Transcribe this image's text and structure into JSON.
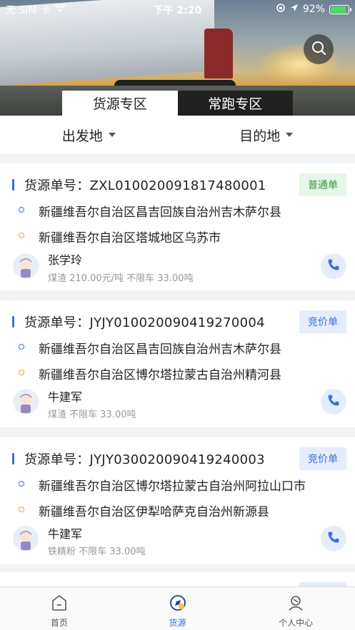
{
  "status_bar": {
    "carrier": "无 SIM 卡",
    "time": "下午 2:20",
    "battery": "92%",
    "battery_level": 0.92
  },
  "header": {
    "search_icon": "search-icon",
    "tabs": [
      {
        "label": "货源专区",
        "active": true
      },
      {
        "label": "常跑专区",
        "active": false
      }
    ]
  },
  "filters": {
    "origin_label": "出发地",
    "destination_label": "目的地"
  },
  "cards": [
    {
      "order_label": "货源单号：",
      "order_no": "ZXL010020091817480001",
      "badge": "普通单",
      "badge_type": "normal",
      "from": "新疆维吾尔自治区昌吉回族自治州吉木萨尔县",
      "to": "新疆维吾尔自治区塔城地区乌苏市",
      "contact": "张学玲",
      "meta": "煤渣 210.00元/吨 不限车 33.00吨"
    },
    {
      "order_label": "货源单号：",
      "order_no": "JYJY010020090419270004",
      "badge": "竞价单",
      "badge_type": "bid",
      "from": "新疆维吾尔自治区昌吉回族自治州吉木萨尔县",
      "to": "新疆维吾尔自治区博尔塔拉蒙古自治州精河县",
      "contact": "牛建军",
      "meta": "煤渣 不限车 33.00吨"
    },
    {
      "order_label": "货源单号：",
      "order_no": "JYJY030020090419240003",
      "badge": "竞价单",
      "badge_type": "bid",
      "from": "新疆维吾尔自治区博尔塔拉蒙古自治州阿拉山口市",
      "to": "新疆维吾尔自治区伊犁哈萨克自治州新源县",
      "contact": "牛建军",
      "meta": "铁精粉 不限车 33.00吨"
    }
  ],
  "bottom_nav": [
    {
      "label": "首页",
      "icon": "home-icon",
      "active": false
    },
    {
      "label": "货源",
      "icon": "compass-icon",
      "active": true
    },
    {
      "label": "个人中心",
      "icon": "user-center-icon",
      "active": false
    }
  ],
  "colors": {
    "accent": "#3a6fe0",
    "origin_dot": "#3a6fe0",
    "destination_dot": "#f0a23a",
    "normal_badge": "#2c9c3b",
    "bid_badge": "#3a6fe0"
  }
}
